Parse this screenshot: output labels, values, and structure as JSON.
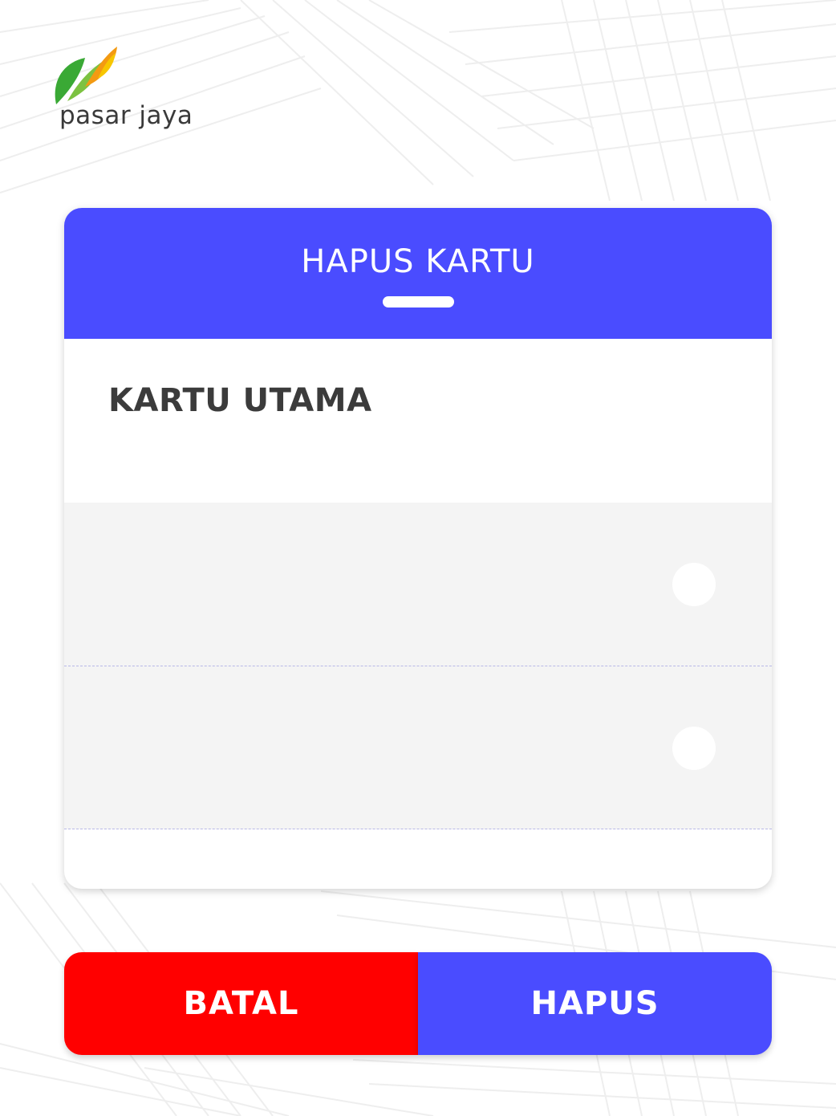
{
  "brand": {
    "logo_text": "pasar jaya",
    "colors": {
      "green": "#3aa935",
      "orange": "#f39a12",
      "yellow": "#f7c600"
    }
  },
  "dialog": {
    "title": "HAPUS KARTU",
    "header_color": "#4a4cff",
    "cards": [
      {
        "label": "KARTU UTAMA",
        "selected": true
      },
      {
        "label": "",
        "selected": false
      },
      {
        "label": "",
        "selected": false
      }
    ],
    "selected_color": "#5200ff"
  },
  "actions": {
    "cancel_label": "BATAL",
    "cancel_color": "#ff0000",
    "delete_label": "HAPUS",
    "delete_color": "#4a4cff"
  }
}
